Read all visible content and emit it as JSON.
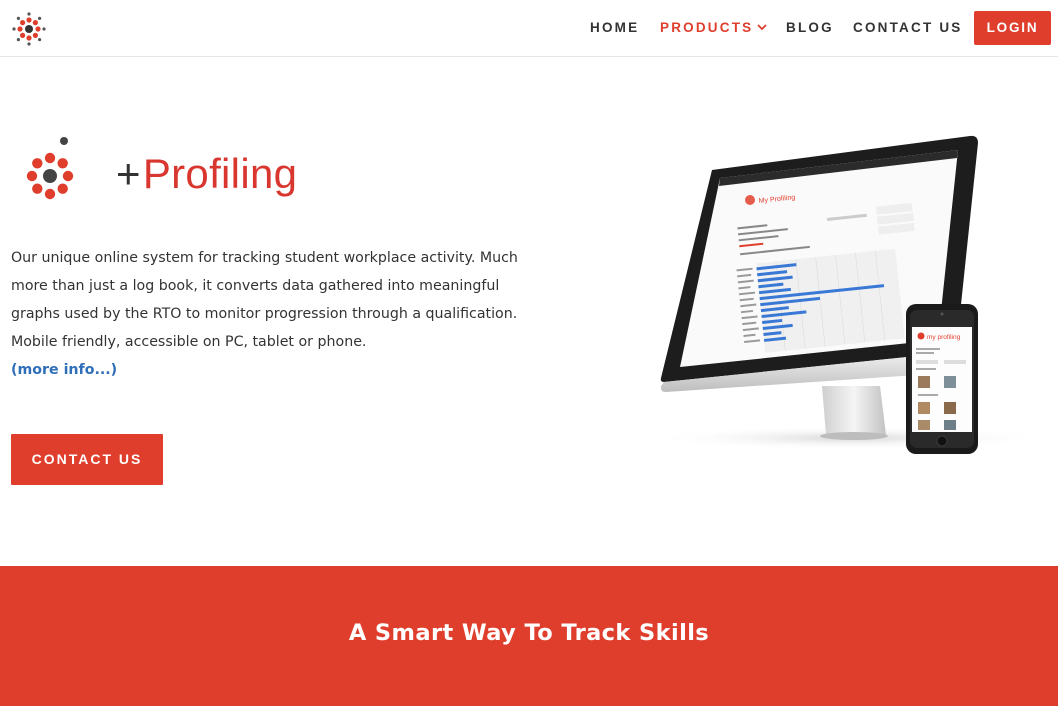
{
  "nav": {
    "home": "HOME",
    "products": "PRODUCTS",
    "blog": "BLOG",
    "contact": "CONTACT US",
    "login": "LOGIN",
    "active": "products"
  },
  "brand": {
    "plus": "+",
    "name": "Profiling"
  },
  "hero": {
    "description": "Our unique online system for tracking student workplace activity. Much more than just a log book, it converts data gathered into meaningful graphs used by the RTO to monitor progression through a qualification. Mobile friendly, accessible on PC, tablet or phone.",
    "more_link": "(more info...)",
    "cta": "CONTACT US"
  },
  "screen": {
    "app_title": "My Profiling",
    "phone_title": "my profiling"
  },
  "banner": {
    "title": "A Smart Way To Track Skills"
  },
  "colors": {
    "accent": "#e03e2d",
    "link": "#2f6eb9",
    "text": "#333333"
  },
  "icons": {
    "logo": "dots-logo-icon",
    "dropdown": "chevron-down-icon"
  }
}
